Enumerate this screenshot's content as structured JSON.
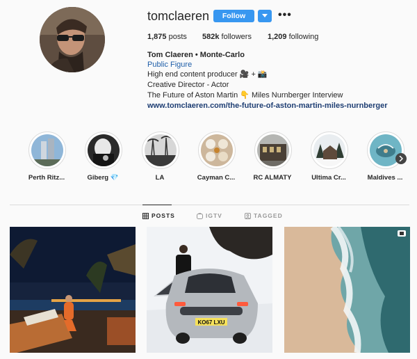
{
  "profile": {
    "username": "tomclaeren",
    "follow_label": "Follow",
    "more_label": "•••",
    "stats": {
      "posts_value": "1,875",
      "posts_label": "posts",
      "followers_value": "582k",
      "followers_label": "followers",
      "following_value": "1,209",
      "following_label": "following"
    },
    "bio": {
      "name_line": "Tom Claeren • Monte-Carlo",
      "category": "Public Figure",
      "line1": "High end content producer 🎥 + 📸",
      "line2": "Creative Director - Actor",
      "line3": "The Future of Aston Martin 👇 Miles Nurnberger Interview",
      "link": "www.tomclaeren.com/the-future-of-aston-martin-miles-nurnberger"
    }
  },
  "highlights": [
    {
      "label": "Perth Ritz..."
    },
    {
      "label": "Giberg 💎"
    },
    {
      "label": "LA"
    },
    {
      "label": "Cayman C..."
    },
    {
      "label": "RC ALMATY"
    },
    {
      "label": "Ultima Cr..."
    },
    {
      "label": "Maldives ..."
    }
  ],
  "tabs": [
    {
      "label": "POSTS",
      "icon": "grid-icon"
    },
    {
      "label": "IGTV",
      "icon": "igtv-icon"
    },
    {
      "label": "TAGGED",
      "icon": "tagged-icon"
    }
  ],
  "posts": {
    "car_plate": "KO67 LXU"
  },
  "colors": {
    "accent": "#3897f0",
    "link": "#1e3e73",
    "category": "#1e5ea8",
    "text": "#262626",
    "background": "#fafafa"
  }
}
